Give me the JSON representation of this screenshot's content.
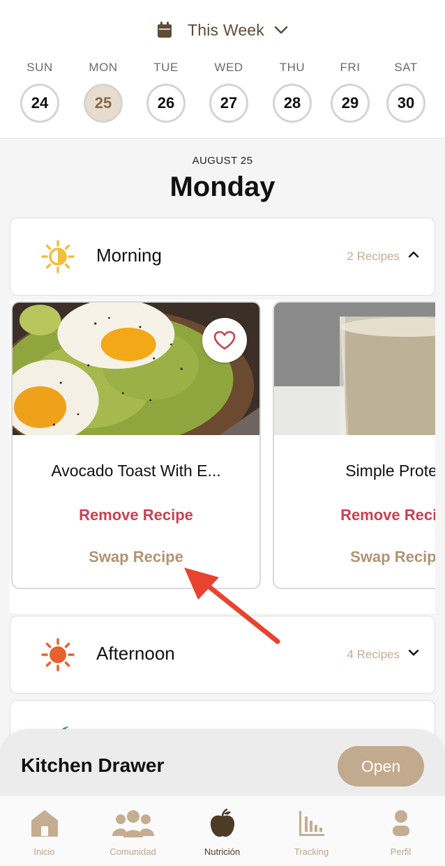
{
  "header": {
    "week_label": "This Week",
    "days": [
      {
        "name": "SUN",
        "num": "24"
      },
      {
        "name": "MON",
        "num": "25"
      },
      {
        "name": "TUE",
        "num": "26"
      },
      {
        "name": "WED",
        "num": "27"
      },
      {
        "name": "THU",
        "num": "28"
      },
      {
        "name": "FRI",
        "num": "29"
      },
      {
        "name": "SAT",
        "num": "30"
      }
    ],
    "selected_day": "MON"
  },
  "day": {
    "date": "AUGUST 25",
    "weekday": "Monday"
  },
  "meals": {
    "morning": {
      "name": "Morning",
      "count": "2 Recipes",
      "icon": "sun-half-icon",
      "expanded": true,
      "recipes": [
        {
          "title": "Avocado Toast With E...",
          "remove": "Remove Recipe",
          "swap": "Swap Recipe",
          "favorite_icon": "heart-icon"
        },
        {
          "title": "Simple Protein",
          "remove": "Remove Recipe",
          "swap": "Swap Recipe"
        }
      ]
    },
    "afternoon": {
      "name": "Afternoon",
      "count": "4 Recipes",
      "icon": "sun-icon",
      "expanded": false
    }
  },
  "drawer": {
    "title": "Kitchen Drawer",
    "open_label": "Open"
  },
  "nav": {
    "items": [
      {
        "label": "Inicio",
        "icon": "home-icon"
      },
      {
        "label": "Comunidad",
        "icon": "community-icon"
      },
      {
        "label": "Nutrición",
        "icon": "apple-icon"
      },
      {
        "label": "Tracking",
        "icon": "chart-icon"
      },
      {
        "label": "Perfil",
        "icon": "profile-icon"
      }
    ],
    "active": "Nutrición"
  },
  "colors": {
    "accent_brown": "#5f4c36",
    "selected_day_bg": "#e8dccd",
    "remove_red": "#c94150",
    "swap_tan": "#b09472",
    "morning_sun": "#f2bf3c",
    "afternoon_sun": "#e8612c",
    "annotation_arrow": "#e8432e"
  }
}
